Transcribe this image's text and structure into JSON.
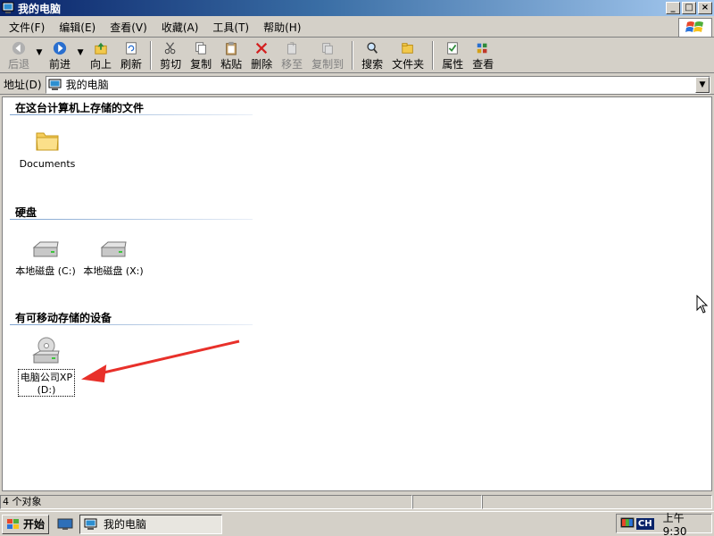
{
  "window": {
    "title": "我的电脑",
    "controls": {
      "minimize": "_",
      "maximize": "□",
      "close": "×"
    }
  },
  "menu": [
    {
      "label": "文件(F)"
    },
    {
      "label": "编辑(E)"
    },
    {
      "label": "查看(V)"
    },
    {
      "label": "收藏(A)"
    },
    {
      "label": "工具(T)"
    },
    {
      "label": "帮助(H)"
    }
  ],
  "toolbar": {
    "back": "后退",
    "forward": "前进",
    "up": "向上",
    "refresh": "刷新",
    "cut": "剪切",
    "copy": "复制",
    "paste": "粘贴",
    "delete": "删除",
    "move_to": "移至",
    "copy_to": "复制到",
    "search": "搜索",
    "folders": "文件夹",
    "properties": "属性",
    "views": "查看"
  },
  "address": {
    "label": "地址(D)",
    "value": "我的电脑"
  },
  "groups": {
    "stored_files": {
      "header": "在这台计算机上存储的文件",
      "items": [
        {
          "label": "Documents"
        }
      ]
    },
    "hard_disks": {
      "header": "硬盘",
      "items": [
        {
          "label": "本地磁盘 (C:)"
        },
        {
          "label": "本地磁盘 (X:)"
        }
      ]
    },
    "removable": {
      "header": "有可移动存储的设备",
      "items": [
        {
          "label_line1": "电脑公司XP",
          "label_line2": "(D:)"
        }
      ]
    }
  },
  "status": {
    "objects": "4 个对象"
  },
  "taskbar": {
    "start": "开始",
    "task": "我的电脑",
    "lang": "CH",
    "clock": "上午 9:30"
  },
  "colors": {
    "titlebar_start": "#0a246a",
    "titlebar_end": "#a6caf0",
    "annotation_arrow": "#e8302a",
    "chrome": "#d4d0c8"
  }
}
